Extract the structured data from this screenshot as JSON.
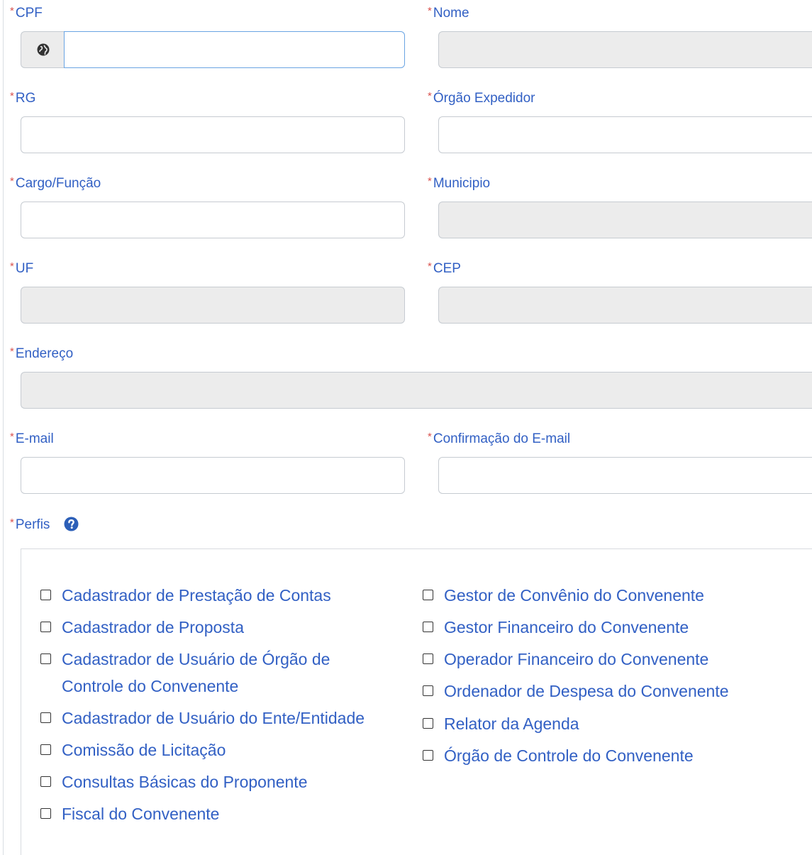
{
  "form": {
    "cpf_label": "CPF",
    "nome_label": "Nome",
    "rg_label": "RG",
    "orgao_label": "Órgão Expedidor",
    "cargo_label": "Cargo/Função",
    "municipio_label": "Municipio",
    "uf_label": "UF",
    "cep_label": "CEP",
    "endereco_label": "Endereço",
    "email_label": "E-mail",
    "email_confirm_label": "Confirmação do E-mail",
    "perfis_label": "Perfis",
    "required_mark": "*",
    "cpf_value": "",
    "cpf_addon_icon": "globe-icon",
    "perfis_help_icon": "question-circle-icon"
  },
  "perfis": {
    "left": [
      {
        "label": "Cadastrador de Prestação de Contas",
        "checked": false
      },
      {
        "label": "Cadastrador de Proposta",
        "checked": false
      },
      {
        "label": "Cadastrador de Usuário de Órgão de",
        "label2": "Controle do Convenente",
        "checked": false
      },
      {
        "label": "Cadastrador de Usuário do Ente/Entidade",
        "checked": false
      },
      {
        "label": "Comissão de Licitação",
        "checked": false
      },
      {
        "label": "Consultas Básicas do Proponente",
        "checked": false
      },
      {
        "label": "Fiscal do Convenente",
        "checked": false
      }
    ],
    "right": [
      {
        "label": "Gestor de Convênio do Convenente",
        "checked": false
      },
      {
        "label": "Gestor Financeiro do Convenente",
        "checked": false
      },
      {
        "label": "Operador Financeiro do Convenente",
        "checked": false
      },
      {
        "label": "Ordenador de Despesa do Convenente",
        "checked": false
      },
      {
        "label": "Relator da Agenda",
        "checked": false
      },
      {
        "label": "Órgão de Controle do Convenente",
        "checked": false
      }
    ]
  },
  "colors": {
    "label": "#3260c4",
    "required": "#d9534f",
    "disabled_bg": "#ececec",
    "focus_border": "#6aa4e3"
  }
}
